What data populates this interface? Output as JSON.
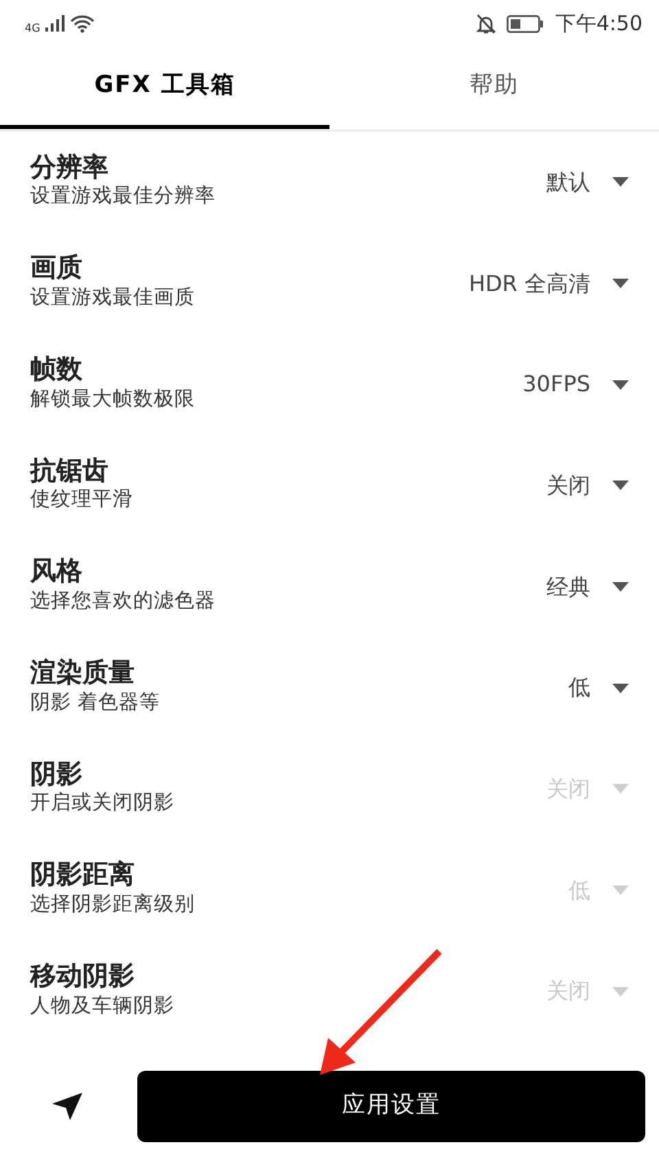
{
  "status_bar": {
    "network": "4G",
    "time": "下午4:50"
  },
  "tabs": [
    {
      "label": "GFX 工具箱",
      "selected": true
    },
    {
      "label": "帮助",
      "selected": false
    }
  ],
  "settings": [
    {
      "title": "分辨率",
      "subtitle": "设置游戏最佳分辨率",
      "value": "默认",
      "disabled": false
    },
    {
      "title": "画质",
      "subtitle": "设置游戏最佳画质",
      "value": "HDR 全高清",
      "disabled": false
    },
    {
      "title": "帧数",
      "subtitle": "解锁最大帧数极限",
      "value": "30FPS",
      "disabled": false
    },
    {
      "title": "抗锯齿",
      "subtitle": "使纹理平滑",
      "value": "关闭",
      "disabled": false
    },
    {
      "title": "风格",
      "subtitle": "选择您喜欢的滤色器",
      "value": "经典",
      "disabled": false
    },
    {
      "title": "渲染质量",
      "subtitle": "阴影 着色器等",
      "value": "低",
      "disabled": false
    },
    {
      "title": "阴影",
      "subtitle": "开启或关闭阴影",
      "value": "关闭",
      "disabled": true
    },
    {
      "title": "阴影距离",
      "subtitle": "选择阴影距离级别",
      "value": "低",
      "disabled": true
    },
    {
      "title": "移动阴影",
      "subtitle": "人物及车辆阴影",
      "value": "关闭",
      "disabled": true
    }
  ],
  "apply_button": {
    "label": "应用设置"
  }
}
